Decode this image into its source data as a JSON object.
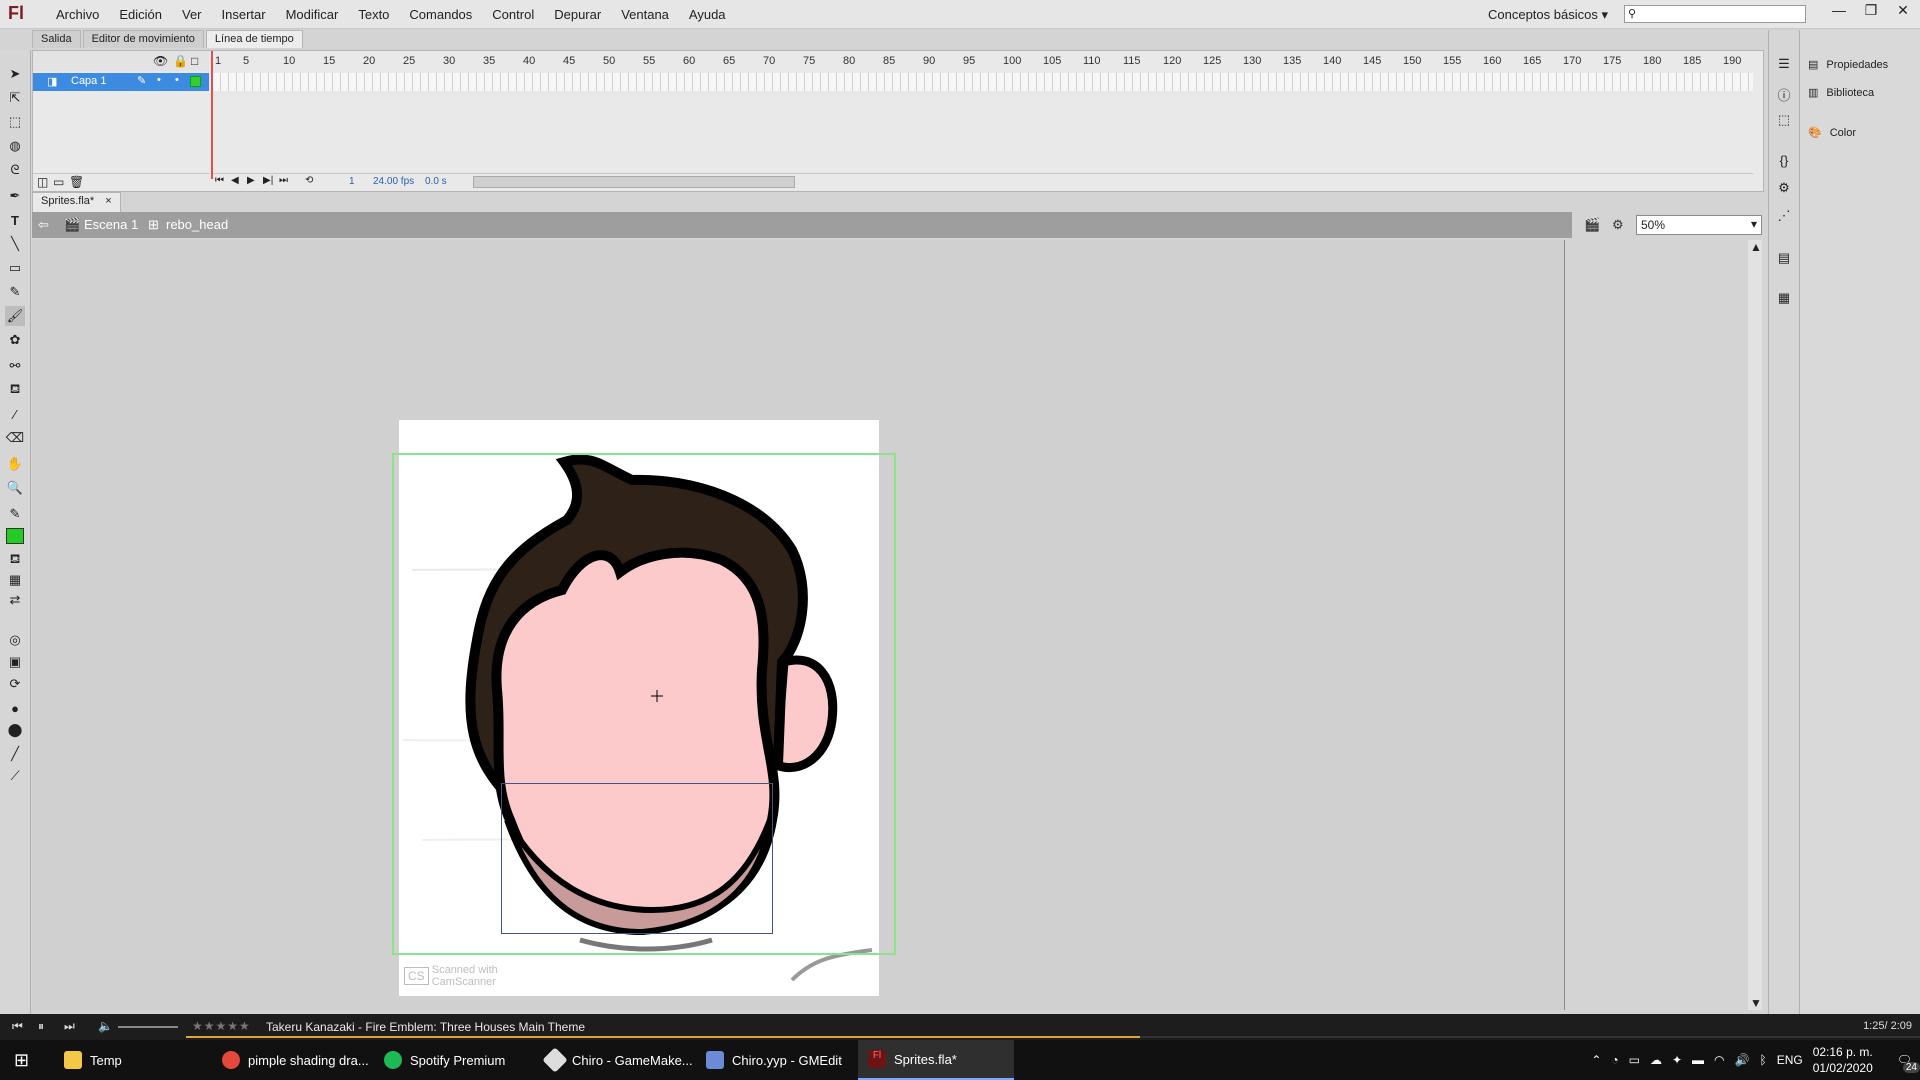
{
  "app": {
    "logo": "Fl",
    "menus": [
      "Archivo",
      "Edición",
      "Ver",
      "Insertar",
      "Modificar",
      "Texto",
      "Comandos",
      "Control",
      "Depurar",
      "Ventana",
      "Ayuda"
    ],
    "workspace": "Conceptos básicos",
    "window_buttons": [
      "—",
      "❐",
      "✕"
    ]
  },
  "panel_tabs": [
    "Salida",
    "Editor de movimiento",
    "Línea de tiempo"
  ],
  "timeline": {
    "layer_name": "Capa 1",
    "ruler_ticks": [
      "1",
      "5",
      "10",
      "15",
      "20",
      "25",
      "30",
      "35",
      "40",
      "45",
      "50",
      "55",
      "60",
      "65",
      "70",
      "75",
      "80",
      "85",
      "90",
      "95",
      "100",
      "105",
      "110",
      "115",
      "120",
      "125",
      "130",
      "135",
      "140",
      "145",
      "150",
      "155",
      "160",
      "165",
      "170",
      "175",
      "180",
      "185",
      "190"
    ],
    "current_frame": "1",
    "fps": "24.00 fps",
    "seconds": "0.0 s"
  },
  "document": {
    "tab": "Sprites.fla*",
    "tab_close": "×",
    "scene": "Escena 1",
    "symbol": "rebo_head",
    "zoom": "50%",
    "watermark": "Scanned with CamScanner"
  },
  "right_panel": {
    "items": [
      "Propiedades",
      "Biblioteca",
      "Color"
    ]
  },
  "media": {
    "track": "Takeru Kanazaki - Fire Emblem: Three Houses Main Theme",
    "time": "1:25/ 2:09",
    "progress_fraction": 0.55
  },
  "taskbar": {
    "items": [
      "Temp",
      "pimple shading dra...",
      "Spotify Premium",
      "Chiro - GameMake...",
      "Chiro.yyp - GMEdit",
      "Sprites.fla*"
    ],
    "language": "ENG",
    "time": "02:16 p. m.",
    "date": "01/02/2020",
    "notifications": "24"
  },
  "colors": {
    "hair": "#2e2218",
    "skin": "#fccaca",
    "outline": "#000000",
    "bounds": "#8ee38a",
    "layer_selected": "#3d8be0",
    "fill_swatch": "#22cc22"
  }
}
